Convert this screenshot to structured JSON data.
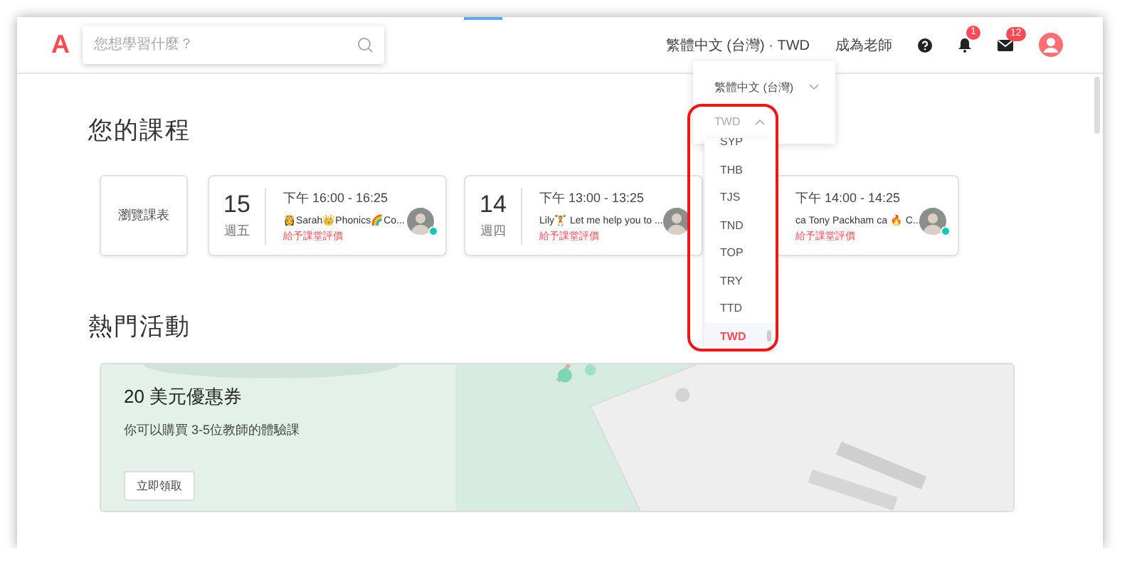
{
  "header": {
    "logo": "A",
    "search": {
      "placeholder": "您想學習什麼？"
    },
    "locale_link": "繁體中文 (台灣) · TWD",
    "teacher_link": "成為老師",
    "notifications_badge": "1",
    "messages_badge": "12"
  },
  "locale_menu": {
    "language": "繁體中文 (台灣)",
    "language_expanded": false,
    "currency": "TWD",
    "currency_expanded": true,
    "currencies": [
      {
        "code": "SYP",
        "selected": false
      },
      {
        "code": "THB",
        "selected": false
      },
      {
        "code": "TJS",
        "selected": false
      },
      {
        "code": "TND",
        "selected": false
      },
      {
        "code": "TOP",
        "selected": false
      },
      {
        "code": "TRY",
        "selected": false
      },
      {
        "code": "TTD",
        "selected": false
      },
      {
        "code": "TWD",
        "selected": true
      }
    ]
  },
  "courses": {
    "title": "您的課程",
    "browse_label": "瀏覽課表",
    "lessons": [
      {
        "day": "15",
        "weekday": "週五",
        "time": "下午 16:00 - 16:25",
        "title": "👸Sarah👑Phonics🌈Co...",
        "action": "給予課堂評價",
        "online": true
      },
      {
        "day": "14",
        "weekday": "週四",
        "time": "下午 13:00 - 13:25",
        "title": "Lily🏋 Let me help you to ...",
        "action": "給予課堂評價",
        "online": false
      },
      {
        "time": "下午 14:00 - 14:25",
        "title": "ca Tony Packham ca 🔥 C...",
        "action": "給予課堂評價",
        "online": true
      }
    ]
  },
  "events": {
    "title": "熱門活動",
    "banner": {
      "kind": "picture",
      "title": "20 美元優惠券",
      "subtitle": "你可以購買 3-5位教師的體驗課",
      "button": "立即領取"
    }
  }
}
